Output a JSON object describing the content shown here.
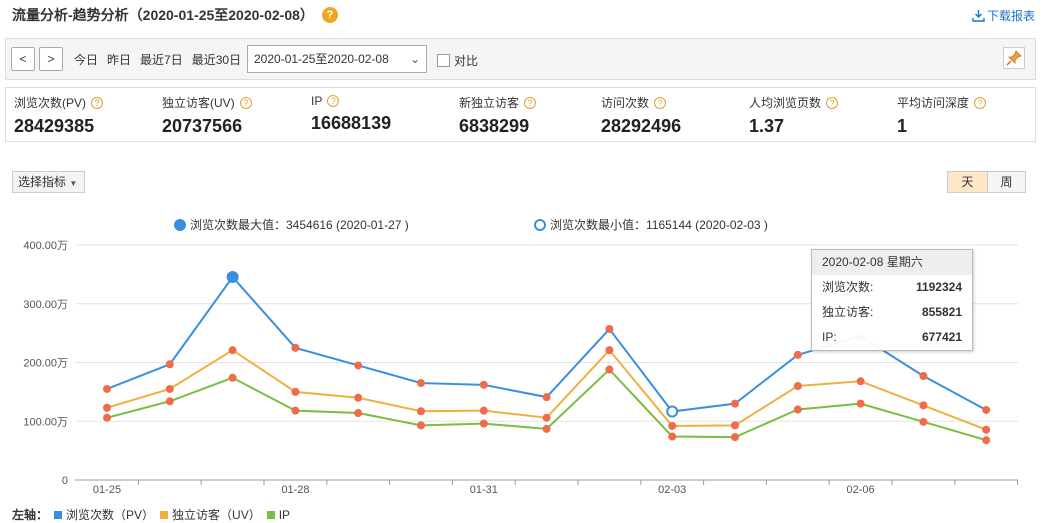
{
  "header": {
    "title": "流量分析-趋势分析（2020-01-25至2020-02-08）",
    "help": "?",
    "download_label": "下载报表"
  },
  "toolbar": {
    "prev": "<",
    "next": ">",
    "ranges": [
      "今日",
      "昨日",
      "最近7日",
      "最近30日"
    ],
    "date_range": "2020-01-25至2020-02-08",
    "compare_label": "对比"
  },
  "metrics": [
    {
      "label": "浏览次数(PV)",
      "value": "28429385"
    },
    {
      "label": "独立访客(UV)",
      "value": "20737566"
    },
    {
      "label": "IP",
      "value": "16688139"
    },
    {
      "label": "新独立访客",
      "value": "6838299"
    },
    {
      "label": "访问次数",
      "value": "28292496"
    },
    {
      "label": "人均浏览页数",
      "value": "1.37"
    },
    {
      "label": "平均访问深度",
      "value": "1"
    }
  ],
  "controls": {
    "select_metric": "选择指标",
    "day": "天",
    "week": "周"
  },
  "legend_top": {
    "max": "浏览次数最大值：3454616 (2020-01-27 )",
    "min": "浏览次数最小值：1165144 (2020-02-03 )"
  },
  "tooltip": {
    "header": "2020-02-08 星期六",
    "rows": [
      {
        "label": "浏览次数:",
        "value": "1192324"
      },
      {
        "label": "独立访客:",
        "value": "855821"
      },
      {
        "label": "IP:",
        "value": "677421"
      }
    ]
  },
  "bottom_legend": {
    "prefix": "左轴：",
    "items": [
      "浏览次数（PV）",
      "独立访客（UV）",
      "IP"
    ]
  },
  "colors": {
    "pv": "#3a8ee0",
    "uv": "#f0b040",
    "ip": "#78bf40",
    "point_red": "#ef6b4a"
  },
  "chart_data": {
    "type": "line",
    "x": [
      "01-25",
      "01-26",
      "01-27",
      "01-28",
      "01-29",
      "01-30",
      "01-31",
      "02-01",
      "02-02",
      "02-03",
      "02-04",
      "02-05",
      "02-06",
      "02-07",
      "02-08"
    ],
    "x_tick_labels": [
      "01-25",
      "01-28",
      "01-31",
      "02-03",
      "02-06"
    ],
    "y_tick_labels": [
      "0",
      "100.00万",
      "200.00万",
      "300.00万",
      "400.00万"
    ],
    "ylim": [
      0,
      4000000
    ],
    "grid": true,
    "series": [
      {
        "name": "浏览次数（PV）",
        "values": [
          1550000,
          1970000,
          3454616,
          2250000,
          1950000,
          1650000,
          1620000,
          1410000,
          2570000,
          1165144,
          1300000,
          2130000,
          2450000,
          1770000,
          1192324
        ]
      },
      {
        "name": "独立访客（UV）",
        "values": [
          1230000,
          1550000,
          2210000,
          1500000,
          1400000,
          1170000,
          1180000,
          1060000,
          2210000,
          920000,
          930000,
          1600000,
          1680000,
          1270000,
          855821
        ]
      },
      {
        "name": "IP",
        "values": [
          1060000,
          1340000,
          1740000,
          1180000,
          1140000,
          930000,
          960000,
          870000,
          1880000,
          740000,
          730000,
          1200000,
          1300000,
          990000,
          677421
        ]
      }
    ]
  }
}
